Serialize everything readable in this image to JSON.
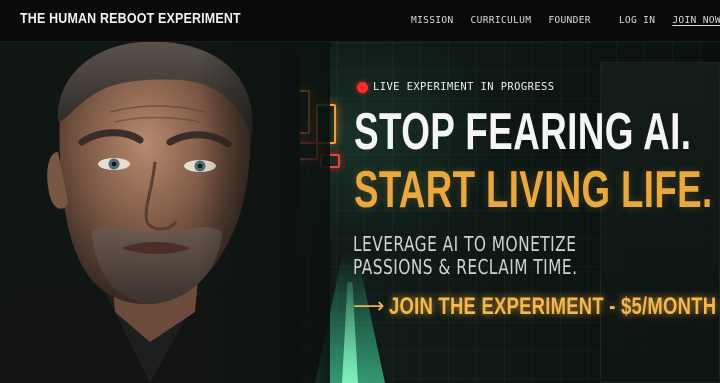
{
  "brand": {
    "name": "THE HUMAN REBOOT EXPERIMENT"
  },
  "nav": {
    "mission": "MISSION",
    "curriculum": "CURRICULUM",
    "founder": "FOUNDER",
    "login": "LOG IN",
    "join": "JOIN NOW"
  },
  "hero": {
    "live_badge": "LIVE EXPERIMENT IN PROGRESS",
    "headline_1": "STOP FEARING AI.",
    "headline_2": "START LIVING LIFE.",
    "sub_1": "LEVERAGE AI TO MONETIZE",
    "sub_2": "PASSIONS & RECLAIM TIME.",
    "cta_arrow": "⟶",
    "cta_label": "JOIN THE EXPERIMENT - $5/MONTH",
    "neon_1": "",
    "neon_2": ""
  },
  "icons": {
    "live": "live-dot-icon",
    "cta": "arrow-right-icon"
  },
  "colors": {
    "accent": "#e9a93f",
    "cta": "#f5b84d",
    "live_dot": "#ff2a2a",
    "nav_bg": "#0a0a0a"
  }
}
